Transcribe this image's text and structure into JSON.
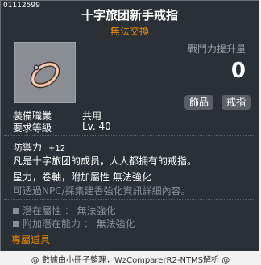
{
  "item": {
    "id": "01112599",
    "title": "十字旅团新手戒指",
    "trade_status": "無法交換",
    "combat_power_label": "戰鬥力提升量",
    "combat_power_value": "0",
    "tags": [
      "飾品",
      "戒指"
    ],
    "job_label": "裝備職業",
    "job_value": "共用",
    "level_label": "要求等級",
    "level_value": "Lv. 40",
    "attack_label": "防禦力",
    "attack_value": "+12",
    "description": "凡是十字旅团的成员，人人都拥有的戒指。",
    "properties": "星力，卷軸，附加屬性 無法強化",
    "npc_note": "可透過NPC/採集建香強化資訊詳細內容。",
    "potential_line": "潛在屬性 ： 無法強化",
    "additional_potential_line": "附加潛在能力 ： 無法強化",
    "exclusive": "專屬道具"
  },
  "footer": {
    "credit": "@ 數據由小冊子整理，WzComparerR2-NTMS解析 @"
  },
  "colors": {
    "background": "#2b3036",
    "accent_orange": "#e88b00",
    "dim_text": "#8a8e94"
  }
}
